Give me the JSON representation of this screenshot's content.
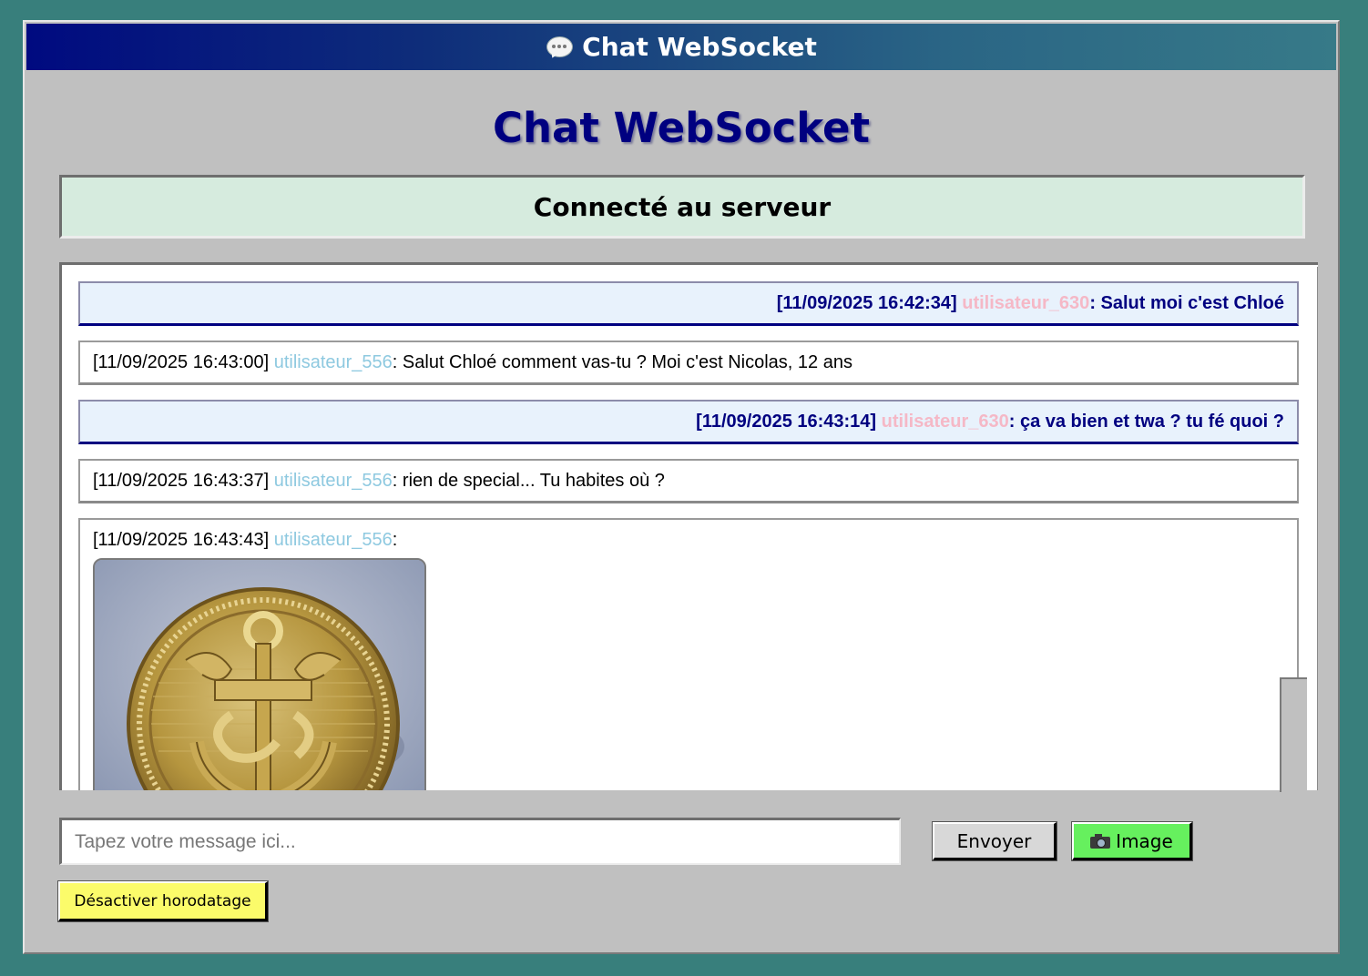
{
  "window": {
    "title": "Chat WebSocket",
    "title_icon": "speech-bubble-icon"
  },
  "page": {
    "heading": "Chat WebSocket"
  },
  "status": {
    "text": "Connecté au serveur",
    "color": "#d6ebde"
  },
  "messages": [
    {
      "own": true,
      "timestamp": "[11/09/2025 16:42:34]",
      "user": "utilisateur_630",
      "text": ": Salut moi c'est Chloé"
    },
    {
      "own": false,
      "timestamp": "[11/09/2025 16:43:00]",
      "user": "utilisateur_556",
      "text": ": Salut Chloé comment vas-tu ? Moi c'est Nicolas, 12 ans"
    },
    {
      "own": true,
      "timestamp": "[11/09/2025 16:43:14]",
      "user": "utilisateur_630",
      "text": ": ça va bien et twa ? tu fé quoi ?"
    },
    {
      "own": false,
      "timestamp": "[11/09/2025 16:43:37]",
      "user": "utilisateur_556",
      "text": ": rien de special... Tu habites où ?"
    },
    {
      "own": false,
      "timestamp": "[11/09/2025 16:43:43]",
      "user": "utilisateur_556",
      "text": ":",
      "image": "anchor-button-photo"
    }
  ],
  "composer": {
    "placeholder": "Tapez votre message ici...",
    "value": "",
    "send_label": "Envoyer",
    "image_label": "Image",
    "image_icon": "camera-icon",
    "timestamp_toggle_label": "Désactiver horodatage"
  },
  "colors": {
    "background": "#387f7c",
    "window": "#c0c0c0",
    "accent": "#000080",
    "own_user": "#f5b8c6",
    "other_user": "#8ec9e0",
    "image_button": "#66f05e",
    "timestamp_button": "#fbfb6a"
  }
}
